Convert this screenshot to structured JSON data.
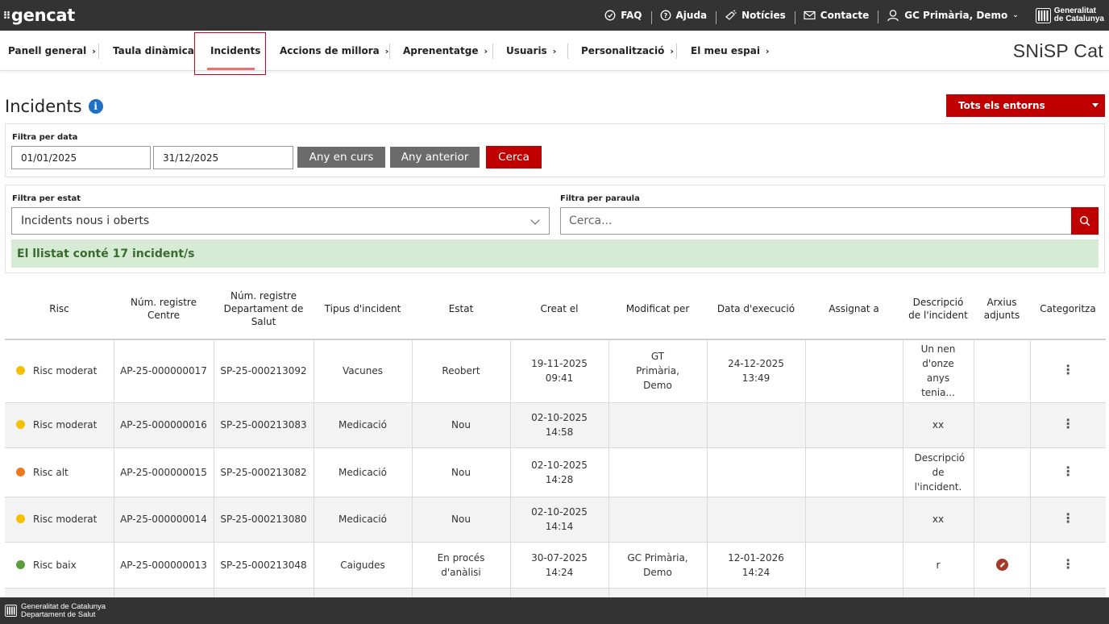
{
  "topbar": {
    "logo_text": "gencat",
    "links": [
      {
        "label": "FAQ",
        "icon": "faq-icon"
      },
      {
        "label": "Ajuda",
        "icon": "help-icon"
      },
      {
        "label": "Notícies",
        "icon": "news-icon"
      },
      {
        "label": "Contacte",
        "icon": "mail-icon"
      },
      {
        "label": "GC Primària, Demo",
        "icon": "user-icon"
      }
    ],
    "brand_line1": "Generalitat",
    "brand_line2": "de Catalunya"
  },
  "nav": {
    "items": [
      "Panell general",
      "Taula dinàmica",
      "Incidents",
      "Accions de millora",
      "Aprenentatge",
      "Usuaris",
      "Personalització",
      "El meu espai"
    ],
    "active": "Incidents",
    "brand": "SNiSP Cat"
  },
  "page": {
    "title": "Incidents",
    "env_dropdown": "Tots els entorns"
  },
  "date_filter": {
    "label": "Filtra per data",
    "from": "01/01/2025",
    "to": "31/12/2025",
    "current_year_btn": "Any en curs",
    "previous_year_btn": "Any anterior",
    "search_btn": "Cerca"
  },
  "status_filter": {
    "label": "Filtra per estat",
    "selected": "Incidents nous i oberts"
  },
  "word_filter": {
    "label": "Filtra per paraula",
    "placeholder": "Cerca..."
  },
  "count_text": "El llistat conté 17 incident/s",
  "table": {
    "headers": {
      "risk": "Risc",
      "center_reg": "Núm. registre Centre",
      "dept_reg": "Núm. registre Departament de Salut",
      "type": "Tipus d'incident",
      "status": "Estat",
      "created": "Creat el",
      "modified_by": "Modificat per",
      "exec_date": "Data d'execució",
      "assigned": "Assignat a",
      "description": "Descripció de l'incident",
      "attachments": "Arxius adjunts",
      "categorize": "Categoritza"
    },
    "risk_colors": {
      "moderat": "#f5c000",
      "alt": "#f07a1a",
      "baix": "#5a9e3a"
    },
    "rows": [
      {
        "risk": "Risc moderat",
        "risk_color": "#f5c000",
        "center_reg": "AP-25-000000017",
        "dept_reg": "SP-25-000213092",
        "type": "Vacunes",
        "status": "Reobert",
        "created_date": "19-11-2025",
        "created_time": "09:41",
        "modified_by": "GT Primària, Demo",
        "exec_date": "24-12-2025",
        "exec_time": "13:49",
        "assigned": "",
        "description": "Un nen d'onze anys tenia...",
        "attachment": false
      },
      {
        "risk": "Risc moderat",
        "risk_color": "#f5c000",
        "center_reg": "AP-25-000000016",
        "dept_reg": "SP-25-000213083",
        "type": "Medicació",
        "status": "Nou",
        "created_date": "02-10-2025",
        "created_time": "14:58",
        "modified_by": "",
        "exec_date": "",
        "exec_time": "",
        "assigned": "",
        "description": "xx",
        "attachment": false
      },
      {
        "risk": "Risc alt",
        "risk_color": "#f07a1a",
        "center_reg": "AP-25-000000015",
        "dept_reg": "SP-25-000213082",
        "type": "Medicació",
        "status": "Nou",
        "created_date": "02-10-2025",
        "created_time": "14:28",
        "modified_by": "",
        "exec_date": "",
        "exec_time": "",
        "assigned": "",
        "description": "Descripció de l'incident.",
        "attachment": false
      },
      {
        "risk": "Risc moderat",
        "risk_color": "#f5c000",
        "center_reg": "AP-25-000000014",
        "dept_reg": "SP-25-000213080",
        "type": "Medicació",
        "status": "Nou",
        "created_date": "02-10-2025",
        "created_time": "14:14",
        "modified_by": "",
        "exec_date": "",
        "exec_time": "",
        "assigned": "",
        "description": "xx",
        "attachment": false
      },
      {
        "risk": "Risc baix",
        "risk_color": "#5a9e3a",
        "center_reg": "AP-25-000000013",
        "dept_reg": "SP-25-000213048",
        "type": "Caigudes",
        "status": "En procés d'anàlisi",
        "created_date": "30-07-2025",
        "created_time": "14:24",
        "modified_by": "GC Primària, Demo",
        "exec_date": "12-01-2026",
        "exec_time": "14:24",
        "assigned": "",
        "description": "r",
        "attachment": true
      }
    ]
  },
  "footer": {
    "line1": "Generalitat de Catalunya",
    "line2": "Departament de Salut"
  }
}
